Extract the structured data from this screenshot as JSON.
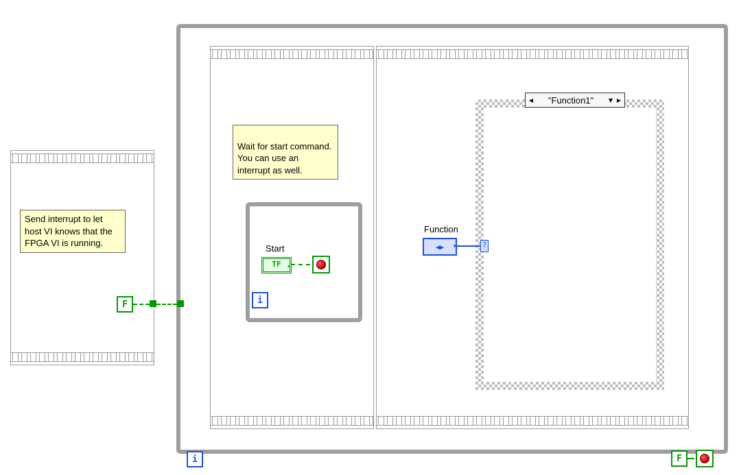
{
  "notes": {
    "interrupt": "Send interrupt to let host VI knows that the FPGA VI is running.",
    "wait": "Wait for start command.\nYou can use an interrupt as well."
  },
  "labels": {
    "start": "Start",
    "function": "Function"
  },
  "case": {
    "current": "\"Function1\"",
    "dropdown": "▾"
  },
  "terminals": {
    "tf": "TF",
    "f": "F",
    "i": "i",
    "q": "?"
  },
  "arrows": {
    "left": "◂",
    "right": "▸",
    "lr": "◂▸"
  }
}
